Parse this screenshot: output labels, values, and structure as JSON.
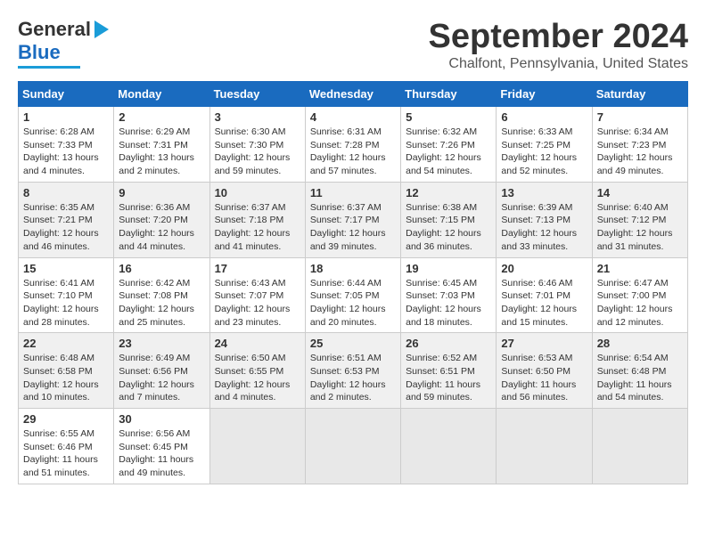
{
  "logo": {
    "line1": "General",
    "line2": "Blue"
  },
  "title": "September 2024",
  "location": "Chalfont, Pennsylvania, United States",
  "days_of_week": [
    "Sunday",
    "Monday",
    "Tuesday",
    "Wednesday",
    "Thursday",
    "Friday",
    "Saturday"
  ],
  "weeks": [
    [
      {
        "day": "1",
        "info": "Sunrise: 6:28 AM\nSunset: 7:33 PM\nDaylight: 13 hours\nand 4 minutes."
      },
      {
        "day": "2",
        "info": "Sunrise: 6:29 AM\nSunset: 7:31 PM\nDaylight: 13 hours\nand 2 minutes."
      },
      {
        "day": "3",
        "info": "Sunrise: 6:30 AM\nSunset: 7:30 PM\nDaylight: 12 hours\nand 59 minutes."
      },
      {
        "day": "4",
        "info": "Sunrise: 6:31 AM\nSunset: 7:28 PM\nDaylight: 12 hours\nand 57 minutes."
      },
      {
        "day": "5",
        "info": "Sunrise: 6:32 AM\nSunset: 7:26 PM\nDaylight: 12 hours\nand 54 minutes."
      },
      {
        "day": "6",
        "info": "Sunrise: 6:33 AM\nSunset: 7:25 PM\nDaylight: 12 hours\nand 52 minutes."
      },
      {
        "day": "7",
        "info": "Sunrise: 6:34 AM\nSunset: 7:23 PM\nDaylight: 12 hours\nand 49 minutes."
      }
    ],
    [
      {
        "day": "8",
        "info": "Sunrise: 6:35 AM\nSunset: 7:21 PM\nDaylight: 12 hours\nand 46 minutes."
      },
      {
        "day": "9",
        "info": "Sunrise: 6:36 AM\nSunset: 7:20 PM\nDaylight: 12 hours\nand 44 minutes."
      },
      {
        "day": "10",
        "info": "Sunrise: 6:37 AM\nSunset: 7:18 PM\nDaylight: 12 hours\nand 41 minutes."
      },
      {
        "day": "11",
        "info": "Sunrise: 6:37 AM\nSunset: 7:17 PM\nDaylight: 12 hours\nand 39 minutes."
      },
      {
        "day": "12",
        "info": "Sunrise: 6:38 AM\nSunset: 7:15 PM\nDaylight: 12 hours\nand 36 minutes."
      },
      {
        "day": "13",
        "info": "Sunrise: 6:39 AM\nSunset: 7:13 PM\nDaylight: 12 hours\nand 33 minutes."
      },
      {
        "day": "14",
        "info": "Sunrise: 6:40 AM\nSunset: 7:12 PM\nDaylight: 12 hours\nand 31 minutes."
      }
    ],
    [
      {
        "day": "15",
        "info": "Sunrise: 6:41 AM\nSunset: 7:10 PM\nDaylight: 12 hours\nand 28 minutes."
      },
      {
        "day": "16",
        "info": "Sunrise: 6:42 AM\nSunset: 7:08 PM\nDaylight: 12 hours\nand 25 minutes."
      },
      {
        "day": "17",
        "info": "Sunrise: 6:43 AM\nSunset: 7:07 PM\nDaylight: 12 hours\nand 23 minutes."
      },
      {
        "day": "18",
        "info": "Sunrise: 6:44 AM\nSunset: 7:05 PM\nDaylight: 12 hours\nand 20 minutes."
      },
      {
        "day": "19",
        "info": "Sunrise: 6:45 AM\nSunset: 7:03 PM\nDaylight: 12 hours\nand 18 minutes."
      },
      {
        "day": "20",
        "info": "Sunrise: 6:46 AM\nSunset: 7:01 PM\nDaylight: 12 hours\nand 15 minutes."
      },
      {
        "day": "21",
        "info": "Sunrise: 6:47 AM\nSunset: 7:00 PM\nDaylight: 12 hours\nand 12 minutes."
      }
    ],
    [
      {
        "day": "22",
        "info": "Sunrise: 6:48 AM\nSunset: 6:58 PM\nDaylight: 12 hours\nand 10 minutes."
      },
      {
        "day": "23",
        "info": "Sunrise: 6:49 AM\nSunset: 6:56 PM\nDaylight: 12 hours\nand 7 minutes."
      },
      {
        "day": "24",
        "info": "Sunrise: 6:50 AM\nSunset: 6:55 PM\nDaylight: 12 hours\nand 4 minutes."
      },
      {
        "day": "25",
        "info": "Sunrise: 6:51 AM\nSunset: 6:53 PM\nDaylight: 12 hours\nand 2 minutes."
      },
      {
        "day": "26",
        "info": "Sunrise: 6:52 AM\nSunset: 6:51 PM\nDaylight: 11 hours\nand 59 minutes."
      },
      {
        "day": "27",
        "info": "Sunrise: 6:53 AM\nSunset: 6:50 PM\nDaylight: 11 hours\nand 56 minutes."
      },
      {
        "day": "28",
        "info": "Sunrise: 6:54 AM\nSunset: 6:48 PM\nDaylight: 11 hours\nand 54 minutes."
      }
    ],
    [
      {
        "day": "29",
        "info": "Sunrise: 6:55 AM\nSunset: 6:46 PM\nDaylight: 11 hours\nand 51 minutes."
      },
      {
        "day": "30",
        "info": "Sunrise: 6:56 AM\nSunset: 6:45 PM\nDaylight: 11 hours\nand 49 minutes."
      },
      {
        "day": "",
        "info": ""
      },
      {
        "day": "",
        "info": ""
      },
      {
        "day": "",
        "info": ""
      },
      {
        "day": "",
        "info": ""
      },
      {
        "day": "",
        "info": ""
      }
    ]
  ]
}
